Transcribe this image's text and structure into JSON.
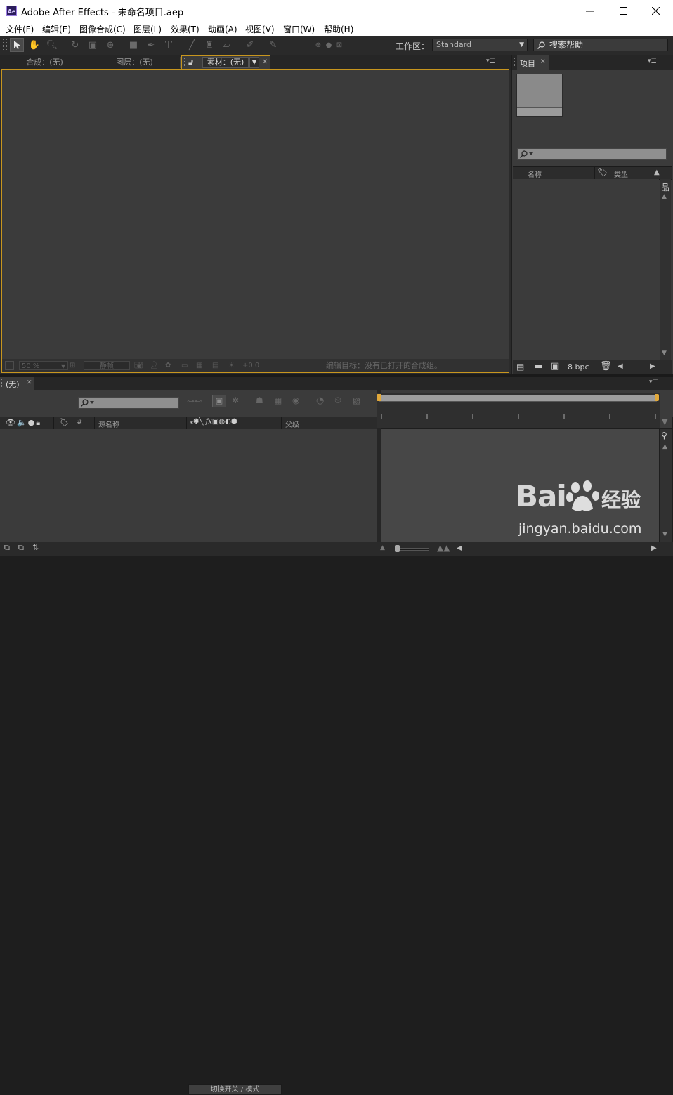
{
  "window": {
    "app_icon": "Ae",
    "title": "Adobe After Effects - 未命名项目.aep",
    "controls": [
      "minimize-icon",
      "maximize-icon",
      "close-icon"
    ]
  },
  "menu": [
    {
      "label": "文件(F)"
    },
    {
      "label": "编辑(E)"
    },
    {
      "label": "图像合成(C)"
    },
    {
      "label": "图层(L)"
    },
    {
      "label": "效果(T)"
    },
    {
      "label": "动画(A)"
    },
    {
      "label": "视图(V)"
    },
    {
      "label": "窗口(W)"
    },
    {
      "label": "帮助(H)"
    }
  ],
  "toolbar": {
    "workspace_label": "工作区：",
    "workspace_value": "Standard",
    "help_placeholder": "搜索帮助"
  },
  "viewer": {
    "tabs": [
      {
        "label": "合成：(无)"
      },
      {
        "label": "图层：(无)"
      },
      {
        "label": "素材：(无)"
      }
    ],
    "zoom": "50 %",
    "frame_label": "静帧",
    "exposure": "+0.0",
    "status": "编辑目标：没有已打开的合成组。"
  },
  "project": {
    "tab": "项目",
    "columns": {
      "name": "名称",
      "type": "类型"
    },
    "bpc": "8 bpc"
  },
  "timeline": {
    "tab": "(无)",
    "columns": {
      "source": "源名称",
      "parent": "父级",
      "hash": "#"
    },
    "toggle_label": "切换开关 / 模式"
  },
  "watermark": {
    "brand": "Bai",
    "brand_suffix": "经验",
    "url": "jingyan.baidu.com"
  },
  "colors": {
    "panel": "#3b3b3b",
    "active_border": "#c8961e",
    "chrome": "#262626"
  }
}
